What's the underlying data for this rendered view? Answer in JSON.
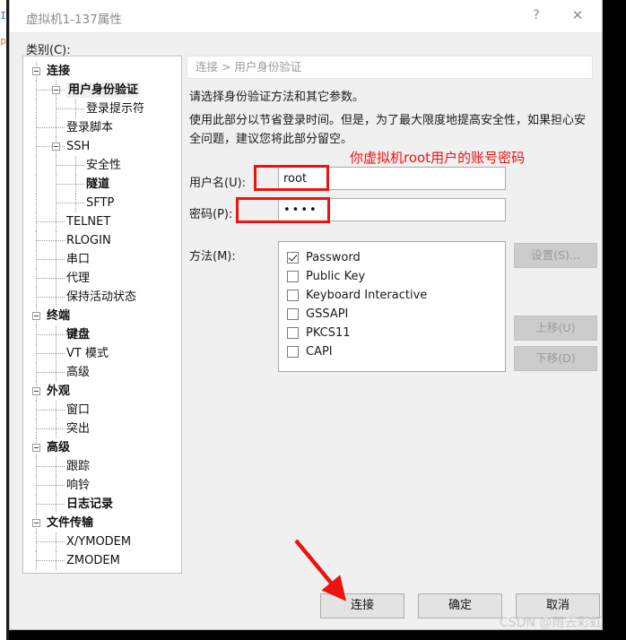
{
  "background_window": {
    "letter_top": "I",
    "letter_bottom": "p"
  },
  "dialog": {
    "title": "虚拟机1-137属性",
    "help_button": "?",
    "close_button": "✕",
    "category_label": "类别(C):"
  },
  "tree": {
    "items": [
      {
        "label": "连接",
        "depth": 0,
        "bold": true,
        "expander": true,
        "selected": false
      },
      {
        "label": "用户身份验证",
        "depth": 1,
        "bold": true,
        "expander": true,
        "selected": true
      },
      {
        "label": "登录提示符",
        "depth": 2,
        "bold": false,
        "expander": false,
        "selected": false
      },
      {
        "label": "登录脚本",
        "depth": 1,
        "bold": false,
        "expander": false,
        "selected": false
      },
      {
        "label": "SSH",
        "depth": 1,
        "bold": false,
        "expander": true,
        "selected": false
      },
      {
        "label": "安全性",
        "depth": 2,
        "bold": false,
        "expander": false,
        "selected": false
      },
      {
        "label": "隧道",
        "depth": 2,
        "bold": true,
        "expander": false,
        "selected": false
      },
      {
        "label": "SFTP",
        "depth": 2,
        "bold": false,
        "expander": false,
        "selected": false
      },
      {
        "label": "TELNET",
        "depth": 1,
        "bold": false,
        "expander": false,
        "selected": false
      },
      {
        "label": "RLOGIN",
        "depth": 1,
        "bold": false,
        "expander": false,
        "selected": false
      },
      {
        "label": "串口",
        "depth": 1,
        "bold": false,
        "expander": false,
        "selected": false
      },
      {
        "label": "代理",
        "depth": 1,
        "bold": false,
        "expander": false,
        "selected": false
      },
      {
        "label": "保持活动状态",
        "depth": 1,
        "bold": false,
        "expander": false,
        "selected": false
      },
      {
        "label": "终端",
        "depth": 0,
        "bold": true,
        "expander": true,
        "selected": false
      },
      {
        "label": "键盘",
        "depth": 1,
        "bold": true,
        "expander": false,
        "selected": false
      },
      {
        "label": "VT 模式",
        "depth": 1,
        "bold": false,
        "expander": false,
        "selected": false
      },
      {
        "label": "高级",
        "depth": 1,
        "bold": false,
        "expander": false,
        "selected": false
      },
      {
        "label": "外观",
        "depth": 0,
        "bold": true,
        "expander": true,
        "selected": false
      },
      {
        "label": "窗口",
        "depth": 1,
        "bold": false,
        "expander": false,
        "selected": false
      },
      {
        "label": "突出",
        "depth": 1,
        "bold": false,
        "expander": false,
        "selected": false
      },
      {
        "label": "高级",
        "depth": 0,
        "bold": true,
        "expander": true,
        "selected": false
      },
      {
        "label": "跟踪",
        "depth": 1,
        "bold": false,
        "expander": false,
        "selected": false
      },
      {
        "label": "响铃",
        "depth": 1,
        "bold": false,
        "expander": false,
        "selected": false
      },
      {
        "label": "日志记录",
        "depth": 1,
        "bold": true,
        "expander": false,
        "selected": false
      },
      {
        "label": "文件传输",
        "depth": 0,
        "bold": true,
        "expander": true,
        "selected": false
      },
      {
        "label": "X/YMODEM",
        "depth": 1,
        "bold": false,
        "expander": false,
        "selected": false
      },
      {
        "label": "ZMODEM",
        "depth": 1,
        "bold": false,
        "expander": false,
        "selected": false
      }
    ]
  },
  "content": {
    "breadcrumb": "连接 > 用户身份验证",
    "description_line1": "请选择身份验证方法和其它参数。",
    "description_line2": "使用此部分以节省登录时间。但是，为了最大限度地提高安全性，如果担心安全问题，建议您将此部分留空。",
    "username_label": "用户名(U):",
    "username_value": "root",
    "password_label": "密码(P):",
    "password_value": "••••",
    "methods_label": "方法(M):",
    "methods": [
      {
        "label": "Password",
        "checked": true
      },
      {
        "label": "Public Key",
        "checked": false
      },
      {
        "label": "Keyboard Interactive",
        "checked": false
      },
      {
        "label": "GSSAPI",
        "checked": false
      },
      {
        "label": "PKCS11",
        "checked": false
      },
      {
        "label": "CAPI",
        "checked": false
      }
    ],
    "side_buttons": {
      "settings": "设置(S)...",
      "move_up": "上移(U)",
      "move_down": "下移(D)"
    }
  },
  "footer": {
    "connect": "连接",
    "ok": "确定",
    "cancel": "取消"
  },
  "annotations": {
    "note_text": "你虚拟机root用户的账号密码",
    "color": "#ee1111",
    "watermark": "CSDN @雨去彩虹"
  }
}
